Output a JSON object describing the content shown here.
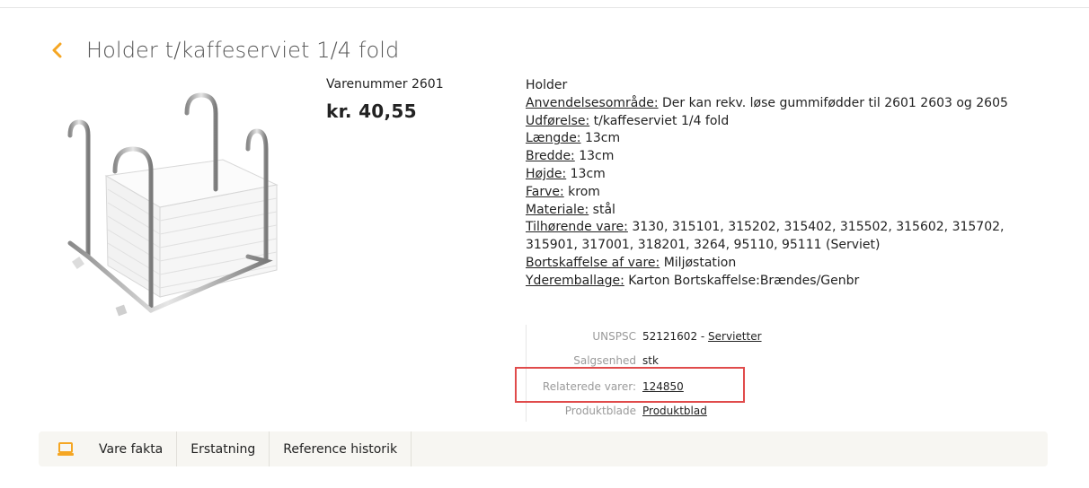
{
  "header": {
    "title": "Holder t/kaffeserviet 1/4 fold"
  },
  "icons": {
    "back": "chevron-left-icon",
    "tab": "laptop-icon",
    "accent": "#f5a623"
  },
  "product": {
    "varenummer": "Varenummer 2601",
    "price": "kr. 40,55"
  },
  "description": {
    "intro": "Holder",
    "rows": [
      {
        "label": "Anvendelsesområde:",
        "value": " Der kan rekv. løse gummifødder til 2601 2603 og 2605"
      },
      {
        "label": "Udførelse:",
        "value": " t/kaffeserviet 1/4 fold"
      },
      {
        "label": "Længde:",
        "value": " 13cm"
      },
      {
        "label": "Bredde:",
        "value": " 13cm"
      },
      {
        "label": "Højde:",
        "value": " 13cm"
      },
      {
        "label": "Farve:",
        "value": " krom"
      },
      {
        "label": "Materiale:",
        "value": " stål"
      },
      {
        "label": "Tilhørende vare:",
        "value": " 3130, 315101, 315202, 315402, 315502, 315602, 315702, 315901, 317001, 318201, 3264, 95110, 95111 (Serviet)"
      },
      {
        "label": "Bortskaffelse af vare:",
        "value": " Miljøstation"
      },
      {
        "label": "Yderemballage:",
        "value": " Karton Bortskaffelse:Brændes/Genbr"
      }
    ]
  },
  "meta": {
    "unspsc_label": "UNSPSC",
    "unspsc_code": "52121602 - ",
    "unspsc_link": "Servietter",
    "salgsenhed_label": "Salgsenhed",
    "salgsenhed_value": "stk",
    "relaterede_label": "Relaterede varer:",
    "relaterede_link": "124850",
    "produktblade_label": "Produktblade",
    "produktblade_link": "Produktblad",
    "highlight_color": "#e04b4b"
  },
  "tabs": [
    "Vare fakta",
    "Erstatning",
    "Reference historik"
  ]
}
